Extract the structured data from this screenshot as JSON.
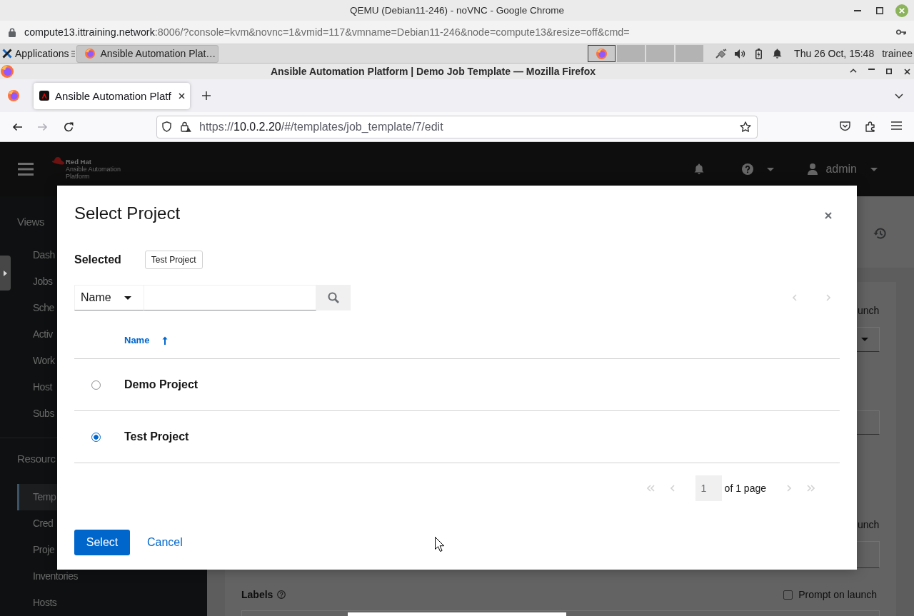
{
  "host_window": {
    "title": "QEMU (Debian11-246) - noVNC - Google Chrome",
    "url_host": "compute13.ittraining.network",
    "url_rest": ":8006/?console=kvm&novnc=1&vmid=117&vmname=Debian11-246&node=compute13&resize=off&cmd="
  },
  "desktop_panel": {
    "menu_label": "Applications",
    "tasks": [
      {
        "label": "Ansible Automation Plat…",
        "selected": true
      }
    ],
    "workspaces": [
      {
        "selected": true
      },
      {
        "selected": false
      },
      {
        "selected": false
      },
      {
        "selected": false
      }
    ],
    "clock": "Thu 26 Oct, 15:48",
    "user": "trainee"
  },
  "browser": {
    "title": "Ansible Automation Platform | Demo Job Template — Mozilla Firefox",
    "tabs": [
      {
        "label": "Ansible Automation Platf",
        "selected": true
      }
    ],
    "back_disabled": false,
    "forward_disabled": true,
    "url": {
      "scheme": "https://",
      "host": "10.0.2.20",
      "path": "/#/templates/job_template/7/edit"
    }
  },
  "app_header": {
    "brand": "Red Hat",
    "product": "Ansible Automation Platform",
    "user": "admin"
  },
  "sidebar": {
    "sections": [
      {
        "title": "Views",
        "items": [
          {
            "label": "Dash",
            "selected": false
          },
          {
            "label": "Jobs",
            "selected": false
          },
          {
            "label": "Sche",
            "selected": false
          },
          {
            "label": "Activ",
            "selected": false
          },
          {
            "label": "Work",
            "selected": false
          },
          {
            "label": "Host",
            "selected": false
          },
          {
            "label": "Subs",
            "selected": false
          }
        ]
      },
      {
        "title": "Resourc",
        "items": [
          {
            "label": "Temp",
            "selected": true
          },
          {
            "label": "Cred",
            "selected": false
          },
          {
            "label": "Proje",
            "selected": false
          },
          {
            "label": "Inventories",
            "selected": false
          },
          {
            "label": "Hosts",
            "selected": false
          }
        ]
      }
    ]
  },
  "form": {
    "fields": [
      {
        "kind": "text",
        "text": "unch"
      },
      {
        "kind": "select"
      },
      {
        "kind": "input"
      },
      {
        "kind": "text",
        "text": "unch"
      },
      {
        "kind": "input"
      }
    ],
    "labels": {
      "label": "Labels",
      "prompt": {
        "label": "Prompt on launch",
        "checked": false
      }
    }
  },
  "modal": {
    "title": "Select Project",
    "selected_label": "Selected",
    "chips": [
      "Test Project"
    ],
    "filter_label": "Name",
    "toolbar_pagination": {
      "previous_disabled": true,
      "next_disabled": true
    },
    "columns": [
      {
        "label": "Name",
        "sorted": true,
        "ascending": true
      }
    ],
    "rows": [
      {
        "name": "Demo Project",
        "selected": false
      },
      {
        "name": "Test Project",
        "selected": true
      }
    ],
    "pagination": {
      "page": "1",
      "page_total": "of 1 page",
      "first_disabled": true,
      "previous_disabled": true,
      "next_disabled": true,
      "last_disabled": true
    },
    "buttons": [
      {
        "label": "Select",
        "kind": "primary"
      },
      {
        "label": "Cancel",
        "kind": "link"
      }
    ]
  }
}
